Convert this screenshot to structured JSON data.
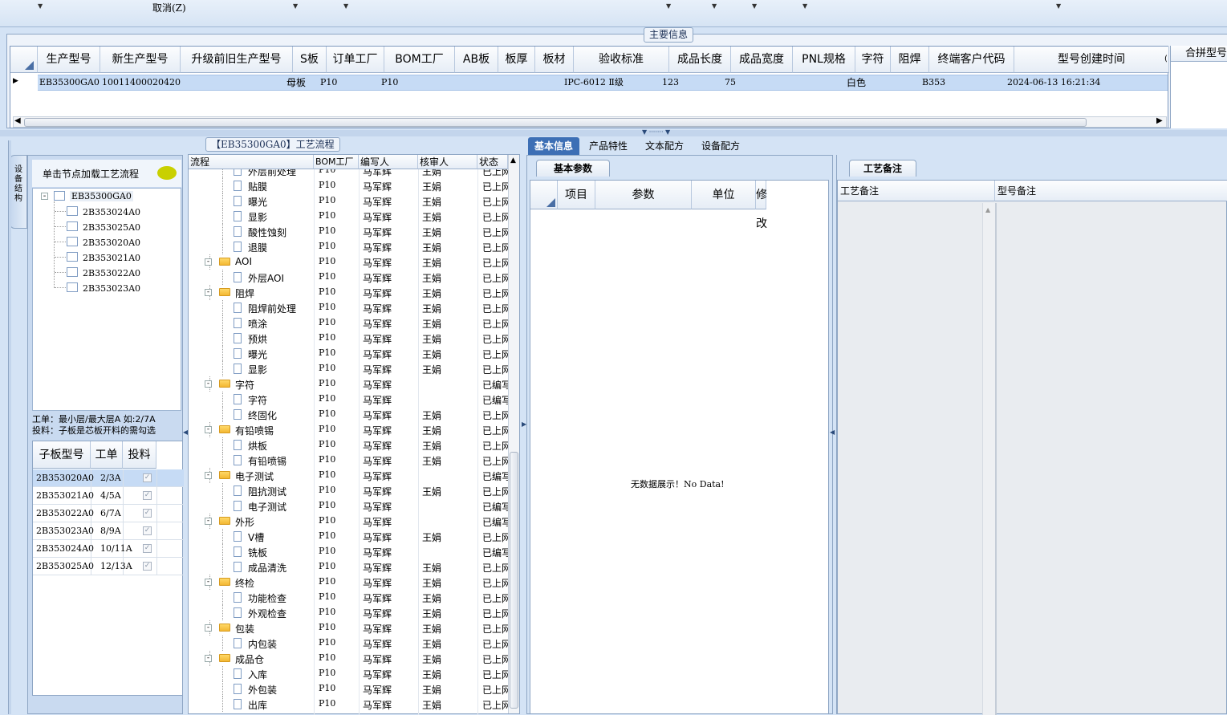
{
  "toolbar": {
    "cancel_label": "取消(Z)"
  },
  "main_group": {
    "title": "主要信息",
    "columns": [
      "生产型号",
      "新生产型号",
      "升级前旧生产型号",
      "S板",
      "订单工厂",
      "BOM工厂",
      "AB板",
      "板厚",
      "板材",
      "验收标准",
      "成品长度",
      "成品宽度",
      "PNL规格",
      "字符",
      "阻焊",
      "终端客户代码",
      "型号创建时间"
    ],
    "row": {
      "prod_no": "EB35300GA0",
      "new_prod_no": "10011400020420",
      "old_prod_no": "",
      "s_board": "母板",
      "order_factory": "P10",
      "bom_factory": "P10",
      "ab_board": "",
      "thickness": "",
      "material": "",
      "standard": "IPC-6012 Ⅱ级",
      "length": "123",
      "width": "75",
      "pnl": "",
      "char": "白色",
      "solder": "",
      "customer": "B353",
      "created": "2024-06-13 16:21:34"
    },
    "right_panel_title": "合拼型号"
  },
  "side_tab": {
    "label": "设备结构"
  },
  "left": {
    "hint": "单击节点加载工艺流程",
    "tree_root": "EB35300GA0",
    "tree_children": [
      "2B353024A0",
      "2B353025A0",
      "2B353020A0",
      "2B353021A0",
      "2B353022A0",
      "2B353023A0"
    ],
    "note1": "工单：最小层/最大层A 如:2/7A",
    "note2": "投料：子板是芯板开料的需勾选",
    "sub_columns": [
      "子板型号",
      "工单",
      "投料"
    ],
    "sub_rows": [
      {
        "model": "2B353020A0",
        "order": "2/3A",
        "checked": true
      },
      {
        "model": "2B353021A0",
        "order": "4/5A",
        "checked": true
      },
      {
        "model": "2B353022A0",
        "order": "6/7A",
        "checked": true
      },
      {
        "model": "2B353023A0",
        "order": "8/9A",
        "checked": true
      },
      {
        "model": "2B353024A0",
        "order": "10/11A",
        "checked": true
      },
      {
        "model": "2B353025A0",
        "order": "12/13A",
        "checked": true
      }
    ]
  },
  "flow": {
    "title": "【EB35300GA0】工艺流程",
    "columns": [
      "流程",
      "BOM工厂",
      "编写人",
      "核审人",
      "状态"
    ],
    "rows": [
      {
        "name": "外层前处理",
        "level": 2,
        "bom": "P10",
        "writer": "马军辉",
        "reviewer": "王娟",
        "status": "已上网"
      },
      {
        "name": "贴膜",
        "level": 2,
        "bom": "P10",
        "writer": "马军辉",
        "reviewer": "王娟",
        "status": "已上网"
      },
      {
        "name": "曝光",
        "level": 2,
        "bom": "P10",
        "writer": "马军辉",
        "reviewer": "王娟",
        "status": "已上网"
      },
      {
        "name": "显影",
        "level": 2,
        "bom": "P10",
        "writer": "马军辉",
        "reviewer": "王娟",
        "status": "已上网"
      },
      {
        "name": "酸性蚀刻",
        "level": 2,
        "bom": "P10",
        "writer": "马军辉",
        "reviewer": "王娟",
        "status": "已上网"
      },
      {
        "name": "退膜",
        "level": 2,
        "bom": "P10",
        "writer": "马军辉",
        "reviewer": "王娟",
        "status": "已上网"
      },
      {
        "name": "AOI",
        "level": 1,
        "bom": "P10",
        "writer": "马军辉",
        "reviewer": "王娟",
        "status": "已上网"
      },
      {
        "name": "外层AOI",
        "level": 2,
        "bom": "P10",
        "writer": "马军辉",
        "reviewer": "王娟",
        "status": "已上网"
      },
      {
        "name": "阻焊",
        "level": 1,
        "bom": "P10",
        "writer": "马军辉",
        "reviewer": "王娟",
        "status": "已上网"
      },
      {
        "name": "阻焊前处理",
        "level": 2,
        "bom": "P10",
        "writer": "马军辉",
        "reviewer": "王娟",
        "status": "已上网"
      },
      {
        "name": "喷涂",
        "level": 2,
        "bom": "P10",
        "writer": "马军辉",
        "reviewer": "王娟",
        "status": "已上网"
      },
      {
        "name": "预烘",
        "level": 2,
        "bom": "P10",
        "writer": "马军辉",
        "reviewer": "王娟",
        "status": "已上网"
      },
      {
        "name": "曝光",
        "level": 2,
        "bom": "P10",
        "writer": "马军辉",
        "reviewer": "王娟",
        "status": "已上网"
      },
      {
        "name": "显影",
        "level": 2,
        "bom": "P10",
        "writer": "马军辉",
        "reviewer": "王娟",
        "status": "已上网"
      },
      {
        "name": "字符",
        "level": 1,
        "bom": "P10",
        "writer": "马军辉",
        "reviewer": "",
        "status": "已编写"
      },
      {
        "name": "字符",
        "level": 2,
        "bom": "P10",
        "writer": "马军辉",
        "reviewer": "",
        "status": "已编写"
      },
      {
        "name": "终固化",
        "level": 2,
        "bom": "P10",
        "writer": "马军辉",
        "reviewer": "王娟",
        "status": "已上网"
      },
      {
        "name": "有铅喷锡",
        "level": 1,
        "bom": "P10",
        "writer": "马军辉",
        "reviewer": "王娟",
        "status": "已上网"
      },
      {
        "name": "烘板",
        "level": 2,
        "bom": "P10",
        "writer": "马军辉",
        "reviewer": "王娟",
        "status": "已上网"
      },
      {
        "name": "有铅喷锡",
        "level": 2,
        "bom": "P10",
        "writer": "马军辉",
        "reviewer": "王娟",
        "status": "已上网"
      },
      {
        "name": "电子测试",
        "level": 1,
        "bom": "P10",
        "writer": "马军辉",
        "reviewer": "",
        "status": "已编写"
      },
      {
        "name": "阻抗测试",
        "level": 2,
        "bom": "P10",
        "writer": "马军辉",
        "reviewer": "王娟",
        "status": "已上网"
      },
      {
        "name": "电子测试",
        "level": 2,
        "bom": "P10",
        "writer": "马军辉",
        "reviewer": "",
        "status": "已编写"
      },
      {
        "name": "外形",
        "level": 1,
        "bom": "P10",
        "writer": "马军辉",
        "reviewer": "",
        "status": "已编写"
      },
      {
        "name": "V槽",
        "level": 2,
        "bom": "P10",
        "writer": "马军辉",
        "reviewer": "王娟",
        "status": "已上网"
      },
      {
        "name": "铣板",
        "level": 2,
        "bom": "P10",
        "writer": "马军辉",
        "reviewer": "",
        "status": "已编写"
      },
      {
        "name": "成品清洗",
        "level": 2,
        "bom": "P10",
        "writer": "马军辉",
        "reviewer": "王娟",
        "status": "已上网"
      },
      {
        "name": "终检",
        "level": 1,
        "bom": "P10",
        "writer": "马军辉",
        "reviewer": "王娟",
        "status": "已上网"
      },
      {
        "name": "功能检查",
        "level": 2,
        "bom": "P10",
        "writer": "马军辉",
        "reviewer": "王娟",
        "status": "已上网"
      },
      {
        "name": "外观检查",
        "level": 2,
        "bom": "P10",
        "writer": "马军辉",
        "reviewer": "王娟",
        "status": "已上网"
      },
      {
        "name": "包装",
        "level": 1,
        "bom": "P10",
        "writer": "马军辉",
        "reviewer": "王娟",
        "status": "已上网"
      },
      {
        "name": "内包装",
        "level": 2,
        "bom": "P10",
        "writer": "马军辉",
        "reviewer": "王娟",
        "status": "已上网"
      },
      {
        "name": "成品仓",
        "level": 1,
        "bom": "P10",
        "writer": "马军辉",
        "reviewer": "王娟",
        "status": "已上网"
      },
      {
        "name": "入库",
        "level": 2,
        "bom": "P10",
        "writer": "马军辉",
        "reviewer": "王娟",
        "status": "已上网"
      },
      {
        "name": "外包装",
        "level": 2,
        "bom": "P10",
        "writer": "马军辉",
        "reviewer": "王娟",
        "status": "已上网"
      },
      {
        "name": "出库",
        "level": 2,
        "bom": "P10",
        "writer": "马军辉",
        "reviewer": "王娟",
        "status": "已上网"
      }
    ]
  },
  "center": {
    "tabs": [
      "基本信息",
      "产品特性",
      "文本配方",
      "设备配方"
    ],
    "subtab": "基本参数",
    "columns": [
      "项目",
      "参数",
      "单位",
      "修改"
    ],
    "empty": "无数据展示！No Data!"
  },
  "right": {
    "subtab": "工艺备注",
    "columns": [
      "工艺备注",
      "型号备注"
    ]
  },
  "colors": {
    "bg": "#d4e3f5",
    "selected_row": "#c6dbf5",
    "active_tab": "#3d6fb5"
  }
}
